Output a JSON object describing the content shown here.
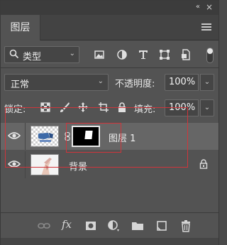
{
  "panel": {
    "tab_label": "图层",
    "collapse_glyph": "«",
    "close_glyph": "×"
  },
  "filter": {
    "kind_label": "类型",
    "chevron": "⌄"
  },
  "blend": {
    "mode": "正常",
    "chevron": "⌄",
    "opacity_label": "不透明度:",
    "opacity_value": "100%"
  },
  "lock": {
    "label": "锁定:",
    "fill_label": "填充:",
    "fill_value": "100%"
  },
  "layers": [
    {
      "name": "图层 1",
      "selected": true,
      "has_mask": true,
      "locked": false
    },
    {
      "name": "背景",
      "selected": false,
      "has_mask": false,
      "locked": true
    }
  ],
  "bottom": {
    "fx_label": "fx"
  },
  "colors": {
    "panel_bg": "#535353",
    "selected_row": "#666666",
    "highlight_box": "#d0353b"
  }
}
